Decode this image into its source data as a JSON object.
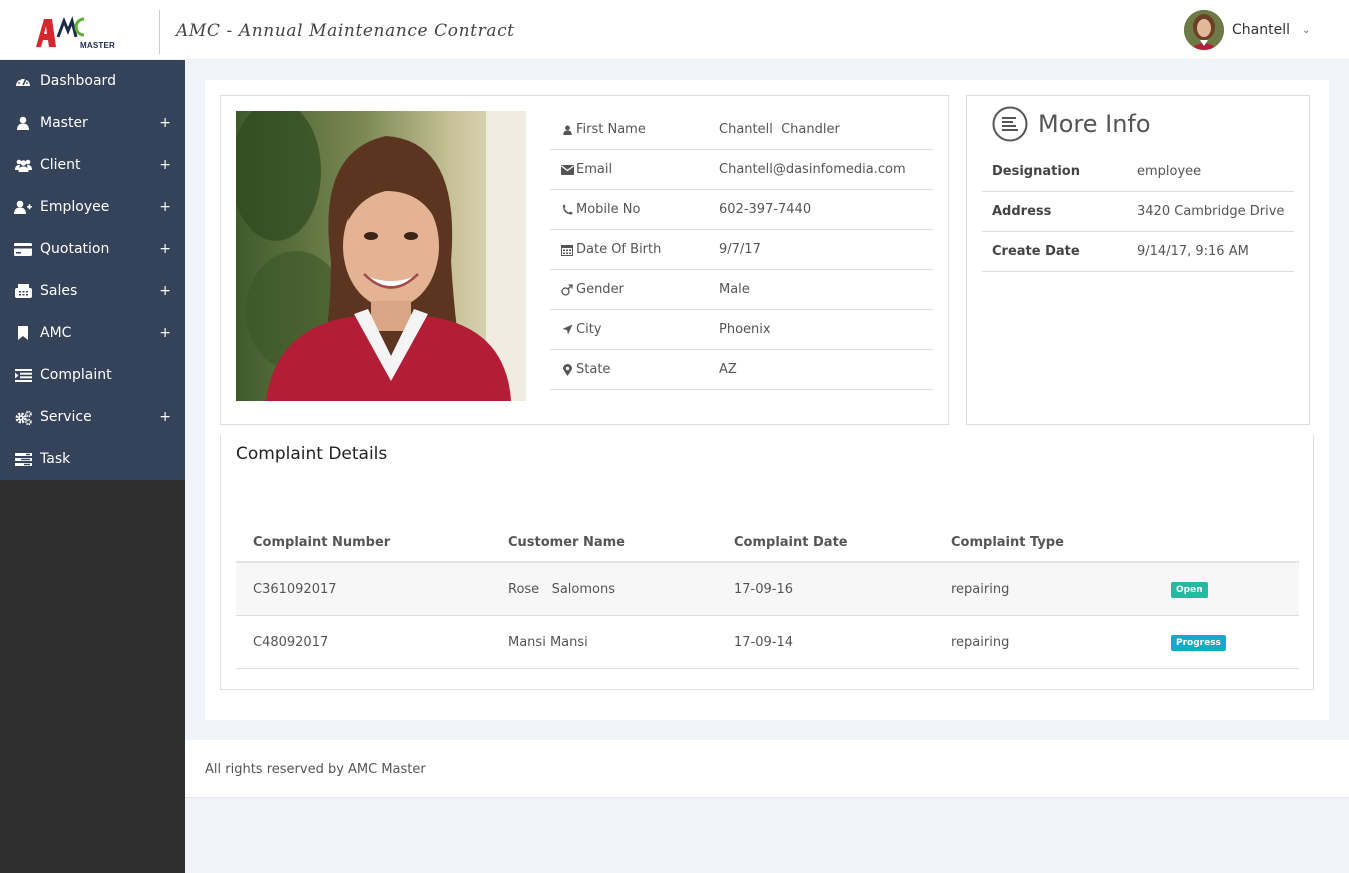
{
  "header": {
    "logo_text": "MASTER",
    "app_title": "AMC - Annual Maintenance Contract",
    "user_name": "Chantell",
    "user_avatar_icon": "user-avatar-photo",
    "dropdown_icon": "chevron-down-icon"
  },
  "sidebar": {
    "items": [
      {
        "label": "Dashboard",
        "icon": "dashboard-icon",
        "expand": ""
      },
      {
        "label": "Master",
        "icon": "user-icon",
        "expand": "+"
      },
      {
        "label": "Client",
        "icon": "users-icon",
        "expand": "+"
      },
      {
        "label": "Employee",
        "icon": "user-plus-icon",
        "expand": "+"
      },
      {
        "label": "Quotation",
        "icon": "credit-card-icon",
        "expand": "+"
      },
      {
        "label": "Sales",
        "icon": "fax-icon",
        "expand": "+"
      },
      {
        "label": "AMC",
        "icon": "bookmark-icon",
        "expand": "+"
      },
      {
        "label": "Complaint",
        "icon": "list-icon",
        "expand": ""
      },
      {
        "label": "Service",
        "icon": "cogs-icon",
        "expand": "+"
      },
      {
        "label": "Task",
        "icon": "tasks-icon",
        "expand": ""
      }
    ]
  },
  "profile": {
    "rows": [
      {
        "label": "First Name",
        "value": "Chantell  Chandler",
        "icon": "user-icon"
      },
      {
        "label": "Email",
        "value": "Chantell@dasinfomedia.com",
        "icon": "envelope-icon"
      },
      {
        "label": "Mobile No",
        "value": "602-397-7440",
        "icon": "phone-icon"
      },
      {
        "label": "Date Of Birth",
        "value": "9/7/17",
        "icon": "calendar-icon"
      },
      {
        "label": "Gender",
        "value": "Male",
        "icon": "mars-icon"
      },
      {
        "label": "City",
        "value": "Phoenix",
        "icon": "location-arrow-icon"
      },
      {
        "label": "State",
        "value": "AZ",
        "icon": "map-marker-icon"
      }
    ]
  },
  "more_info": {
    "title": "More Info",
    "icon": "list-circle-icon",
    "rows": [
      {
        "label": "Designation",
        "value": "employee"
      },
      {
        "label": "Address",
        "value": "3420 Cambridge Drive"
      },
      {
        "label": "Create Date",
        "value": "9/14/17, 9:16 AM"
      }
    ]
  },
  "complaints": {
    "title": "Complaint Details",
    "headers": [
      "Complaint Number",
      "Customer Name",
      "Complaint Date",
      "Complaint Type"
    ],
    "rows": [
      {
        "number": "C361092017",
        "customer": "Rose   Salomons",
        "date": "17-09-16",
        "type": "repairing",
        "status": "Open"
      },
      {
        "number": "C48092017",
        "customer": "Mansi Mansi",
        "date": "17-09-14",
        "type": "repairing",
        "status": "Progress"
      }
    ]
  },
  "footer": {
    "text": "All rights reserved by AMC Master"
  },
  "colors": {
    "sidebar_menu_bg": "#34425a",
    "sidebar_bg": "#2f2f2f",
    "badge_open": "#27b8a2",
    "badge_progress": "#17a9c9",
    "page_bg": "#f0f3f7"
  }
}
